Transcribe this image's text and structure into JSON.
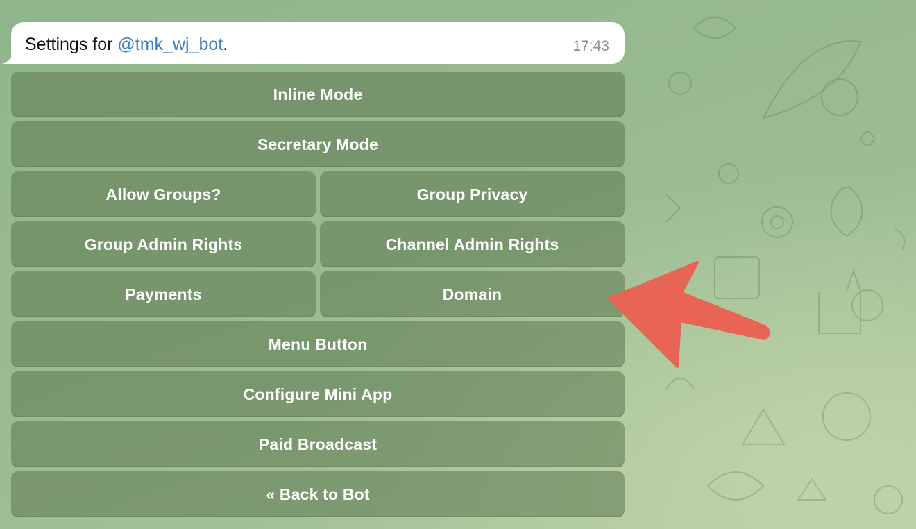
{
  "message": {
    "prefix": "Settings for ",
    "mention": "@tmk_wj_bot",
    "suffix": ".",
    "time": "17:43"
  },
  "keyboard": {
    "rows": [
      [
        "Inline Mode"
      ],
      [
        "Secretary Mode"
      ],
      [
        "Allow Groups?",
        "Group Privacy"
      ],
      [
        "Group Admin Rights",
        "Channel Admin Rights"
      ],
      [
        "Payments",
        "Domain"
      ],
      [
        "Menu Button"
      ],
      [
        "Configure Mini App"
      ],
      [
        "Paid Broadcast"
      ],
      [
        "« Back to Bot"
      ]
    ]
  },
  "annotation": {
    "arrow_color": "#e86455",
    "points_to": "Domain"
  },
  "colors": {
    "background": "#9dbd95",
    "button_fill": "rgba(92,120,80,0.55)",
    "mention": "#3d7fc1"
  }
}
